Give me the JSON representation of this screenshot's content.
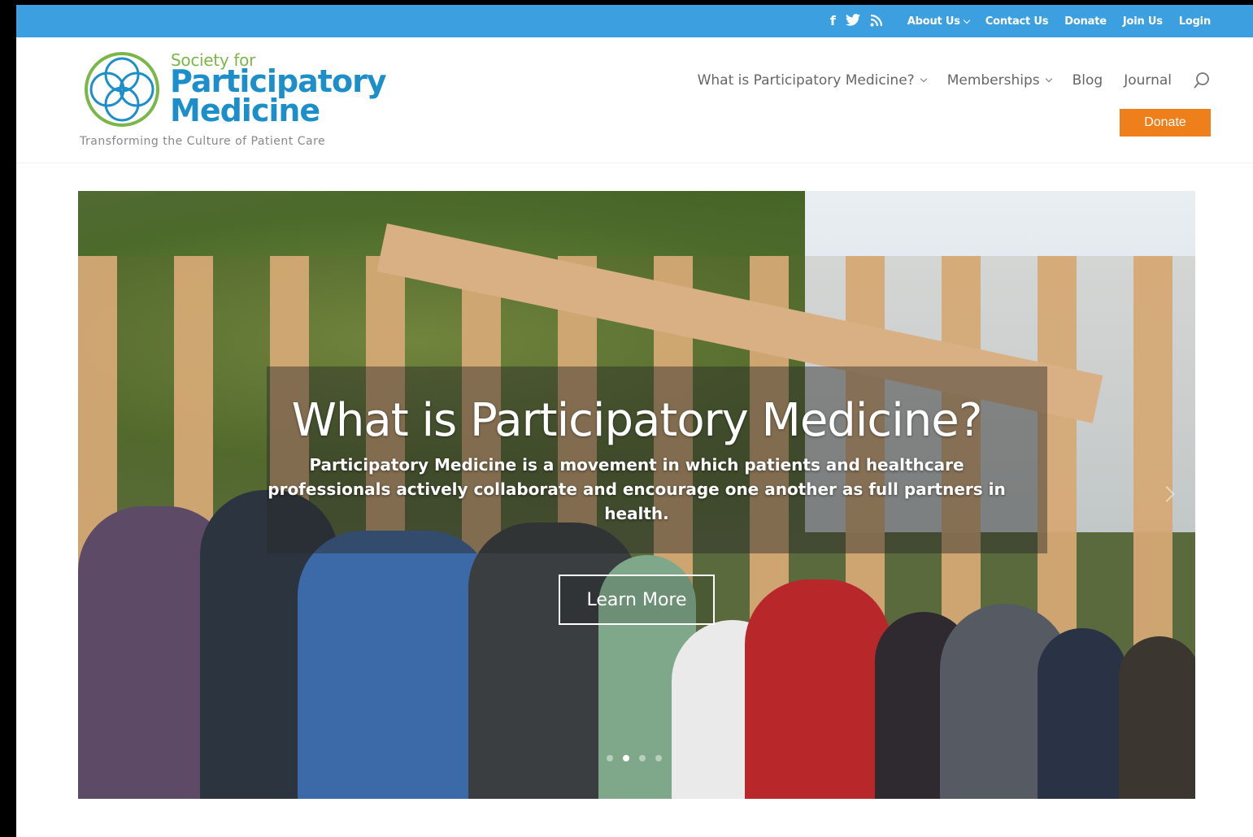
{
  "topbar": {
    "social": [
      "facebook-icon",
      "twitter-icon",
      "rss-icon"
    ],
    "social_glyphs": [
      "f",
      "🐦",
      "⋰"
    ],
    "links": [
      {
        "label": "About Us",
        "dropdown": true
      },
      {
        "label": "Contact Us",
        "dropdown": false
      },
      {
        "label": "Donate",
        "dropdown": false
      },
      {
        "label": "Join Us",
        "dropdown": false
      },
      {
        "label": "Login",
        "dropdown": false
      }
    ],
    "color": "#3ca0e0"
  },
  "logo": {
    "line1": "Society for",
    "line2": "Participatory",
    "line3": "Medicine",
    "tagline": "Transforming the Culture of Patient Care"
  },
  "nav": {
    "items": [
      {
        "label": "What is Participatory Medicine?",
        "dropdown": true
      },
      {
        "label": "Memberships",
        "dropdown": true
      },
      {
        "label": "Blog",
        "dropdown": false
      },
      {
        "label": "Journal",
        "dropdown": false
      }
    ],
    "donate_label": "Donate",
    "donate_color": "#ef7f1a"
  },
  "hero": {
    "title": "What is Participatory Medicine?",
    "subtitle": "Participatory Medicine is a movement in which patients and healthcare professionals actively collaborate and encourage one another as full partners in health.",
    "button_label": "Learn More",
    "slides": 4,
    "active_slide": 2
  }
}
